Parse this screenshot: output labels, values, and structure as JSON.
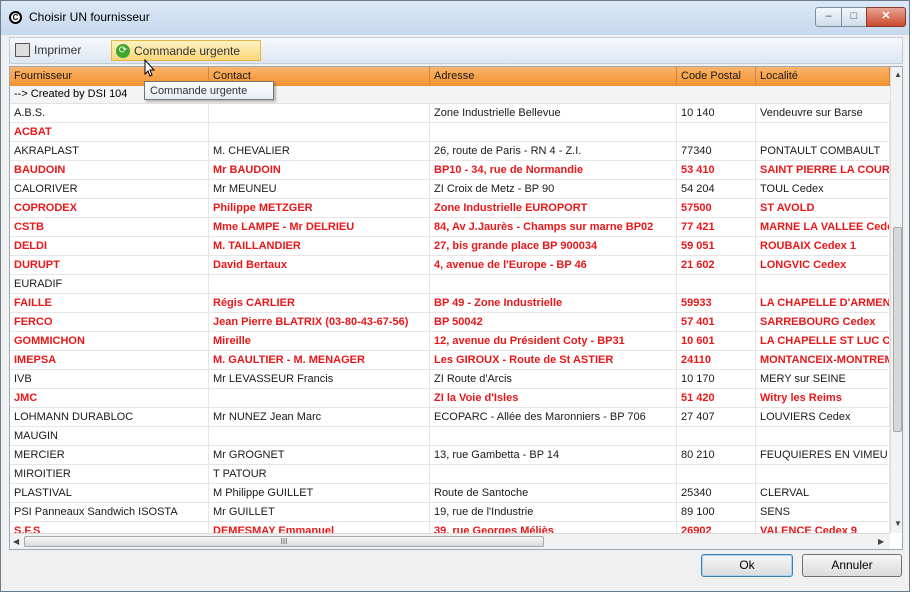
{
  "window": {
    "title": "Choisir UN fournisseur",
    "min_glyph": "–",
    "max_glyph": "□",
    "close_glyph": "✕",
    "icon_glyph": "C"
  },
  "toolbar": {
    "print_label": "Imprimer",
    "urgent_label": "Commande urgente"
  },
  "tooltip": "Commande urgente",
  "columns": [
    "Fournisseur",
    "Contact",
    "Adresse",
    "Code Postal",
    "Localité"
  ],
  "group_label": "--> Created by DSI 104",
  "rows": [
    {
      "f": "A.B.S.",
      "c": "",
      "a": "Zone Industrielle Bellevue",
      "p": "10 140",
      "l": "Vendeuvre sur Barse",
      "red": false
    },
    {
      "f": "ACBAT",
      "c": "",
      "a": "",
      "p": "",
      "l": "",
      "red": true
    },
    {
      "f": "AKRAPLAST",
      "c": "M. CHEVALIER",
      "a": "26, route de Paris  -  RN 4  -  Z.I.",
      "p": "77340",
      "l": "PONTAULT COMBAULT",
      "red": false
    },
    {
      "f": "BAUDOIN",
      "c": "Mr BAUDOIN",
      "a": "BP10 - 34, rue de Normandie",
      "p": "53 410",
      "l": "SAINT PIERRE LA COUR",
      "red": true
    },
    {
      "f": "CALORIVER",
      "c": "Mr MEUNEU",
      "a": "ZI Croix de Metz  -  BP 90",
      "p": "54 204",
      "l": "TOUL Cedex",
      "red": false
    },
    {
      "f": "COPRODEX",
      "c": "Philippe METZGER",
      "a": "Zone Industrielle EUROPORT",
      "p": "57500",
      "l": "ST AVOLD",
      "red": true
    },
    {
      "f": "CSTB",
      "c": "Mme LAMPE - Mr DELRIEU",
      "a": "84, Av J.Jaurès - Champs sur marne  BP02",
      "p": "77 421",
      "l": "MARNE LA VALLEE Cedex",
      "red": true
    },
    {
      "f": "DELDI",
      "c": "M. TAILLANDIER",
      "a": "27, bis grande place      BP 900034",
      "p": "59 051",
      "l": "ROUBAIX Cedex 1",
      "red": true
    },
    {
      "f": "DURUPT",
      "c": "David Bertaux",
      "a": "4, avenue de l'Europe  -  BP 46",
      "p": "21 602",
      "l": "LONGVIC Cedex",
      "red": true
    },
    {
      "f": "EURADIF",
      "c": "",
      "a": "",
      "p": "",
      "l": "",
      "red": false
    },
    {
      "f": "FAILLE",
      "c": "Régis CARLIER",
      "a": "BP 49 - Zone Industrielle",
      "p": "59933",
      "l": "LA CHAPELLE D'ARMENTIERES",
      "red": true
    },
    {
      "f": "FERCO",
      "c": "Jean Pierre BLATRIX (03-80-43-67-56)",
      "a": "BP 50042",
      "p": "57 401",
      "l": "SARREBOURG Cedex",
      "red": true
    },
    {
      "f": "GOMMICHON",
      "c": "Mireille",
      "a": "12, avenue du Président Coty  -  BP31",
      "p": "10 601",
      "l": "LA CHAPELLE ST LUC Cedex",
      "red": true
    },
    {
      "f": "IMEPSA",
      "c": "M. GAULTIER - M. MENAGER",
      "a": "Les GIROUX - Route de St ASTIER",
      "p": "24110",
      "l": "MONTANCEIX-MONTREM",
      "red": true
    },
    {
      "f": "IVB",
      "c": "Mr LEVASSEUR Francis",
      "a": "ZI Route d'Arcis",
      "p": "10 170",
      "l": "MERY sur SEINE",
      "red": false
    },
    {
      "f": "JMC",
      "c": "",
      "a": "ZI la Voie d'Isles",
      "p": "51 420",
      "l": "Witry les Reims",
      "red": true
    },
    {
      "f": "LOHMANN DURABLOC",
      "c": "Mr NUNEZ Jean Marc",
      "a": "ECOPARC - Allée des Maronniers - BP 706",
      "p": "27 407",
      "l": "LOUVIERS Cedex",
      "red": false
    },
    {
      "f": "MAUGIN",
      "c": "",
      "a": "",
      "p": "",
      "l": "",
      "red": false
    },
    {
      "f": "MERCIER",
      "c": "Mr GROGNET",
      "a": "13, rue Gambetta  -  BP 14",
      "p": "80 210",
      "l": "FEUQUIERES EN VIMEU",
      "red": false
    },
    {
      "f": "MIROITIER",
      "c": "T PATOUR",
      "a": "",
      "p": "",
      "l": "",
      "red": false
    },
    {
      "f": "PLASTIVAL",
      "c": "M Philippe GUILLET",
      "a": "Route de Santoche",
      "p": "25340",
      "l": "CLERVAL",
      "red": false
    },
    {
      "f": "PSI Panneaux Sandwich ISOSTA",
      "c": "Mr GUILLET",
      "a": "19, rue de l'Industrie",
      "p": "89 100",
      "l": "SENS",
      "red": false
    },
    {
      "f": "S.F.S",
      "c": "DEMESMAY Emmanuel",
      "a": "39, rue Georges Méliès",
      "p": "26902",
      "l": "VALENCE Cedex 9",
      "red": true
    }
  ],
  "scroll": {
    "up": "▲",
    "down": "▼",
    "left": "◀",
    "right": "▶",
    "grip": "III"
  },
  "buttons": {
    "ok": "Ok",
    "cancel": "Annuler"
  },
  "colors": {
    "header_orange": "#f29230",
    "highlight_red": "#e8181a",
    "urgent_yellow": "#f8d77b"
  }
}
